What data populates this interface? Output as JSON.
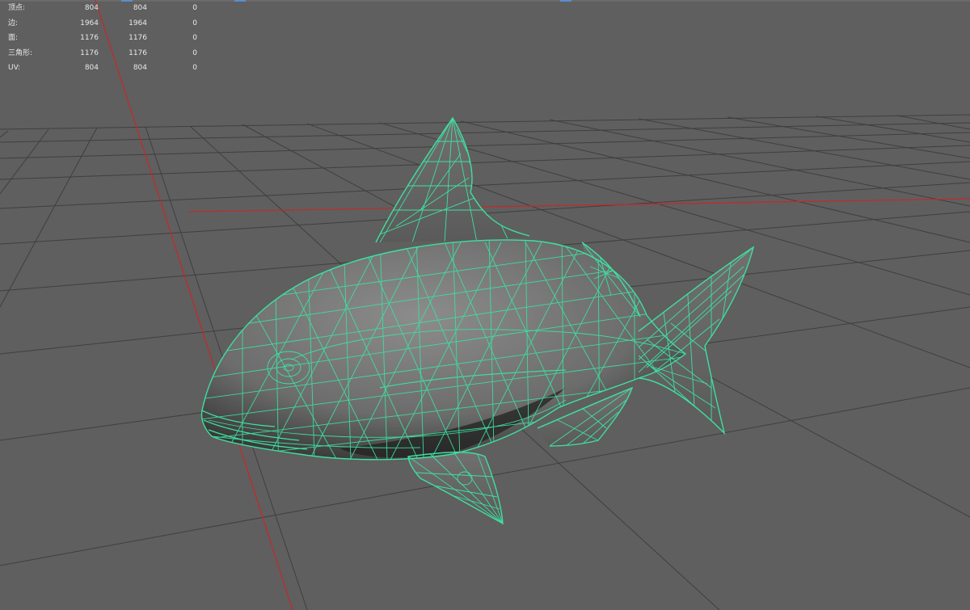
{
  "stats": {
    "rows": [
      {
        "label": "顶点:",
        "v1": "804",
        "v2": "804",
        "v3": "0"
      },
      {
        "label": "边:",
        "v1": "1964",
        "v2": "1964",
        "v3": "0"
      },
      {
        "label": "面:",
        "v1": "1176",
        "v2": "1176",
        "v3": "0"
      },
      {
        "label": "三角形:",
        "v1": "1176",
        "v2": "1176",
        "v3": "0"
      },
      {
        "label": "UV:",
        "v1": "804",
        "v2": "804",
        "v3": "0"
      }
    ]
  },
  "colors": {
    "background": "#5f5f5f",
    "grid": "#3e3e3e",
    "axis": "#c62828",
    "wireframe": "#3ee0a0",
    "mesh_fill": "#7a7a7a",
    "hud_text": "#e8e8e8"
  },
  "scene": {
    "object": "fish-mesh",
    "display_mode": "wireframe-on-shaded"
  }
}
